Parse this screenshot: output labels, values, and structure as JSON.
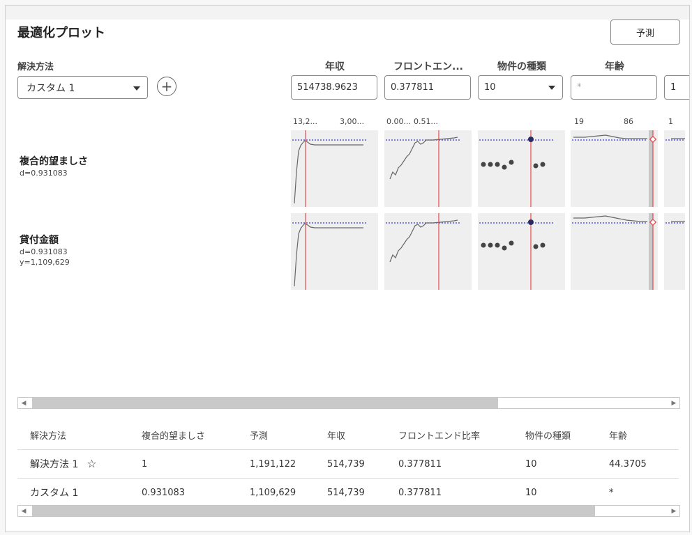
{
  "title": "最適化プロット",
  "predict_button": "予測",
  "solution_method": {
    "label": "解決方法",
    "selected": "カスタム 1",
    "add_symbol": "+"
  },
  "factors": [
    {
      "name": "年収",
      "value": "514738.9623",
      "ticks": [
        "13,2...",
        "3,00..."
      ]
    },
    {
      "name": "フロントエン...",
      "value": "0.377811",
      "ticks": [
        "0.00...",
        "0.51..."
      ]
    },
    {
      "name": "物件の種類",
      "value": "10",
      "ticks": []
    },
    {
      "name": "年齢",
      "value": "",
      "placeholder": "*",
      "ticks": [
        "19",
        "86"
      ]
    },
    {
      "name": "",
      "value": "1",
      "ticks": [
        "1"
      ]
    }
  ],
  "responses": [
    {
      "name": "複合的望ましさ",
      "lines": [
        "d=0.931083"
      ]
    },
    {
      "name": "貸付金額",
      "lines": [
        "d=0.931083",
        "y=1,109,629"
      ]
    }
  ],
  "table": {
    "headers": [
      "解決方法",
      "複合的望ましさ",
      "予測",
      "年収",
      "フロントエンド比率",
      "物件の種類",
      "年齢"
    ],
    "rows": [
      [
        "解決方法 1",
        "1",
        "1,191,122",
        "514,739",
        "0.377811",
        "10",
        "44.3705"
      ],
      [
        "カスタム 1",
        "0.931083",
        "1,109,629",
        "514,739",
        "0.377811",
        "10",
        "*"
      ]
    ],
    "favorite_icon": "☆"
  },
  "colors": {
    "current_line": "#e8474a",
    "target_line": "#3b3bd6",
    "curve": "#666666",
    "plot_bg": "#efefef"
  }
}
